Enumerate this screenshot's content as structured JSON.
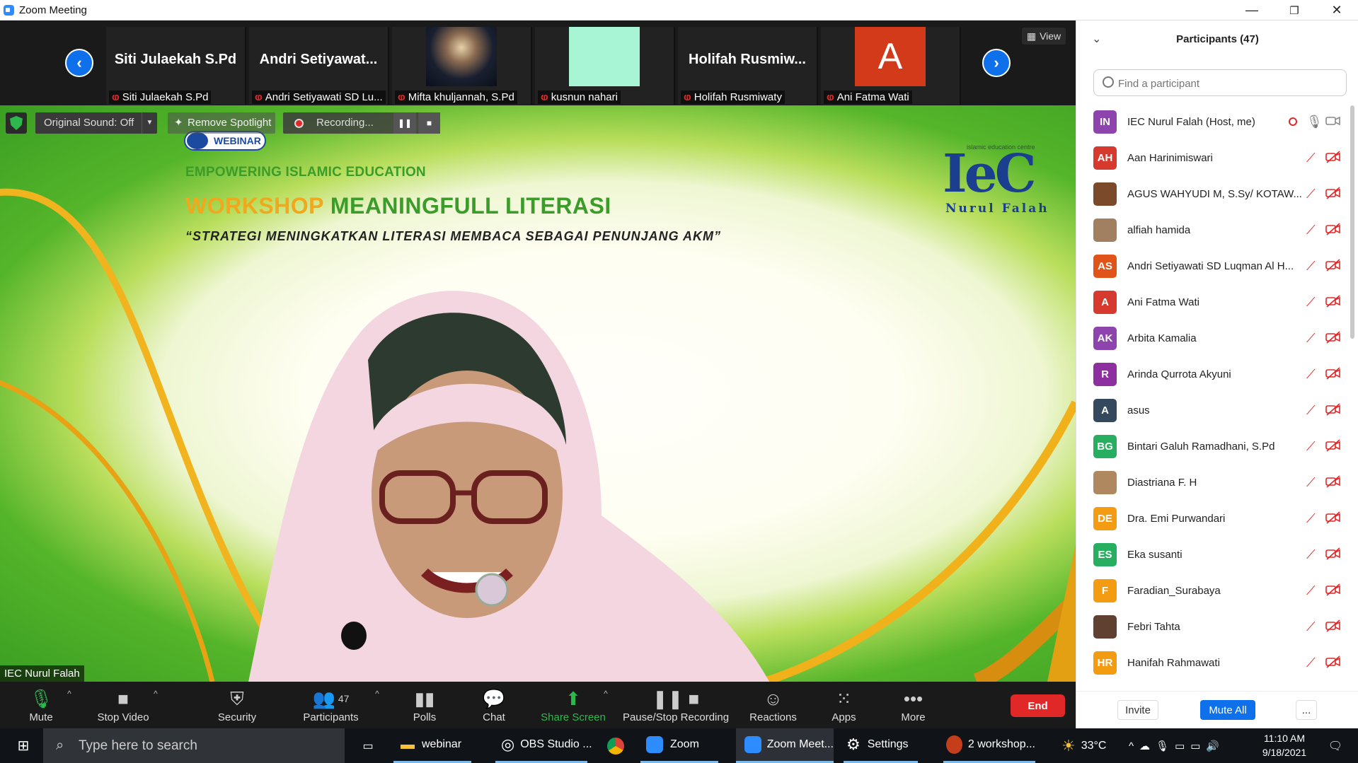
{
  "window": {
    "title": "Zoom Meeting",
    "minimize": "—",
    "restore": "❐",
    "close": "✕"
  },
  "strip": {
    "view_label": "View",
    "thumbs": [
      {
        "big": "Siti Julaekah S.Pd",
        "tag": "Siti Julaekah S.Pd"
      },
      {
        "big": "Andri  Setiyawat...",
        "tag": "Andri Setiyawati SD Lu..."
      },
      {
        "big": "",
        "tag": "Mifta khuljannah, S.Pd"
      },
      {
        "big": "",
        "tag": "kusnun nahari"
      },
      {
        "big": "Holifah  Rusmiw...",
        "tag": "Holifah Rusmiwaty"
      },
      {
        "big": "A",
        "tag": "Ani Fatma Wati"
      }
    ]
  },
  "overlay": {
    "original_sound": "Original Sound: Off",
    "remove_spotlight": "Remove Spotlight",
    "recording": "Recording..."
  },
  "slide": {
    "badge": "WEBINAR",
    "line1": "EMPOWERING ISLAMIC EDUCATION",
    "title_a": "WORKSHOP",
    "title_b": "MEANINGFULL LITERASI",
    "subtitle": "“STRATEGI MENINGKATKAN LITERASI MEMBACA SEBAGAI PENUNJANG AKM”",
    "logo_small": "islamic education centre",
    "logo_big": "IeC",
    "logo_name": "Nurul Falah"
  },
  "speaker_name": "IEC Nurul Falah",
  "toolbar": {
    "mute": "Mute",
    "stop_video": "Stop Video",
    "security": "Security",
    "participants": "Participants",
    "participants_count": "47",
    "polls": "Polls",
    "chat": "Chat",
    "share_screen": "Share Screen",
    "pause_stop_recording": "Pause/Stop Recording",
    "reactions": "Reactions",
    "apps": "Apps",
    "more": "More",
    "end": "End"
  },
  "panel": {
    "title": "Participants (47)",
    "search_placeholder": "Find a participant",
    "participants": [
      {
        "initials": "IN",
        "name": "IEC Nurul Falah (Host, me)",
        "color": "#8e44ad"
      },
      {
        "initials": "AH",
        "name": "Aan Harinimiswari",
        "color": "#d63a2f"
      },
      {
        "initials": "",
        "name": "AGUS WAHYUDI M, S.Sy/ KOTAW...",
        "color": "#7a4a2a"
      },
      {
        "initials": "",
        "name": "alfiah hamida",
        "color": "#a08060"
      },
      {
        "initials": "AS",
        "name": "Andri Setiyawati SD Luqman Al H...",
        "color": "#e0541a"
      },
      {
        "initials": "A",
        "name": "Ani Fatma Wati",
        "color": "#d63a2f"
      },
      {
        "initials": "AK",
        "name": "Arbita Kamalia",
        "color": "#8e44ad"
      },
      {
        "initials": "R",
        "name": "Arinda Qurrota Akyuni",
        "color": "#8e2fa0"
      },
      {
        "initials": "A",
        "name": "asus",
        "color": "#34495e"
      },
      {
        "initials": "BG",
        "name": "Bintari Galuh Ramadhani, S.Pd",
        "color": "#27ae60"
      },
      {
        "initials": "",
        "name": "Diastriana F. H",
        "color": "#b08860"
      },
      {
        "initials": "DE",
        "name": "Dra. Emi Purwandari",
        "color": "#f39c12"
      },
      {
        "initials": "ES",
        "name": "Eka susanti",
        "color": "#27ae60"
      },
      {
        "initials": "F",
        "name": "Faradian_Surabaya",
        "color": "#f39c12"
      },
      {
        "initials": "",
        "name": "Febri Tahta",
        "color": "#604030"
      },
      {
        "initials": "HR",
        "name": "Hanifah Rahmawati",
        "color": "#f39c12"
      }
    ],
    "invite": "Invite",
    "mute_all": "Mute All",
    "more": "..."
  },
  "taskbar": {
    "search_placeholder": "Type here to search",
    "apps": [
      "webinar",
      "OBS Studio ...",
      "Zoom",
      "Zoom Meet...",
      "Settings",
      "2 workshop..."
    ],
    "weather": "33°C",
    "time": "11:10 AM",
    "date": "9/18/2021"
  }
}
